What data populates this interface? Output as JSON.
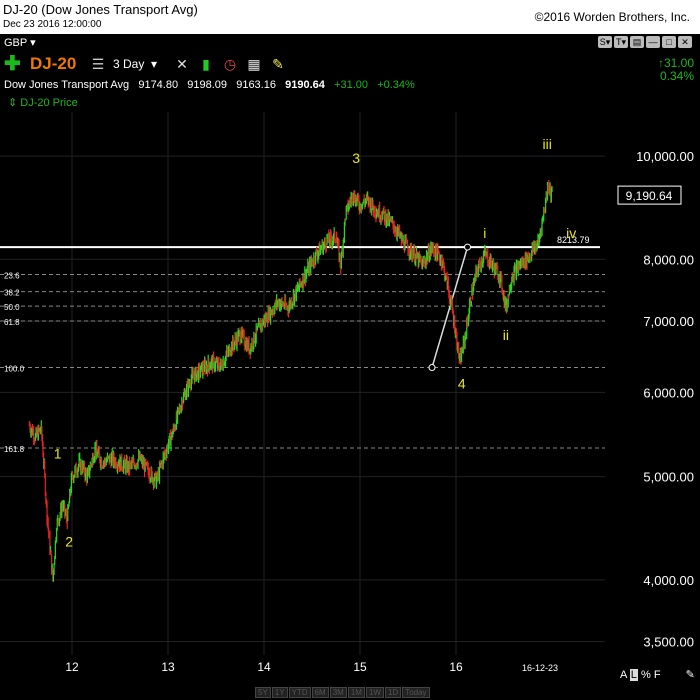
{
  "window": {
    "title": "DJ-20 (Dow Jones Transport Avg)",
    "date": "Dec 23 2016 12:00:00",
    "copyright": "©2016 Worden Brothers, Inc."
  },
  "toolbar": {
    "currency": "GBP",
    "symbol": "DJ-20",
    "period": "3 Day",
    "change_value": "31.00",
    "change_pct": "0.34%",
    "window_buttons": [
      "S",
      "T",
      "min",
      "max",
      "close"
    ]
  },
  "quote": {
    "name": "Dow Jones Transport Avg",
    "open": "9174.80",
    "high": "9198.09",
    "low": "9163.16",
    "last": "9190.64",
    "change": "+31.00",
    "change_pct": "+0.34%"
  },
  "legend": {
    "label": "DJ-20 Price"
  },
  "ranges": [
    "5Y",
    "1Y",
    "YTD",
    "6M",
    "3M",
    "1M",
    "1W",
    "1D",
    "Today"
  ],
  "scale_modes": [
    "A",
    "L",
    "%",
    "F"
  ],
  "colors": {
    "up": "#22dd22",
    "down": "#ee2222",
    "wave_label": "#e8e820",
    "hline": "#ffffff"
  },
  "chart_data": {
    "type": "ohlc",
    "y_scale": "log",
    "ylim": [
      3400,
      11000
    ],
    "y_ticks": [
      3500,
      4000,
      5000,
      6000,
      7000,
      8000,
      10000
    ],
    "y_tick_labels": [
      "3,500.00",
      "4,000.00",
      "5,000.00",
      "6,000.00",
      "7,000.00",
      "8,000.00",
      "10,000.00"
    ],
    "x_ticks": [
      12,
      13,
      14,
      15,
      16
    ],
    "x_tick_labels": [
      "12",
      "13",
      "14",
      "15",
      "16"
    ],
    "x_end_label": "16-12-23",
    "last_price_label": "9,190.64",
    "hline": {
      "value": 8213.79,
      "label": "8213.79"
    },
    "fib_levels": [
      {
        "label": "23.6",
        "value": 7740
      },
      {
        "label": "38.2",
        "value": 7460
      },
      {
        "label": "50.0",
        "value": 7230
      },
      {
        "label": "61.8",
        "value": 7000
      },
      {
        "label": "100.0",
        "value": 6330
      },
      {
        "label": "161.8",
        "value": 5320
      }
    ],
    "waves": [
      {
        "label": "1",
        "x": 11.85,
        "y": 5200
      },
      {
        "label": "2",
        "x": 11.97,
        "y": 4300
      },
      {
        "label": "3",
        "x": 14.96,
        "y": 9850
      },
      {
        "label": "4",
        "x": 16.06,
        "y": 6050
      },
      {
        "label": "i",
        "x": 16.3,
        "y": 8380
      },
      {
        "label": "ii",
        "x": 16.52,
        "y": 6720
      },
      {
        "label": "iii",
        "x": 16.95,
        "y": 10150
      },
      {
        "label": "iv",
        "x": 17.2,
        "y": 8380
      }
    ],
    "series": [
      {
        "name": "DJ-20 Price",
        "points": [
          [
            11.55,
            5600
          ],
          [
            11.62,
            5450
          ],
          [
            11.68,
            5550
          ],
          [
            11.74,
            4600
          ],
          [
            11.8,
            4000
          ],
          [
            11.84,
            4500
          ],
          [
            11.9,
            4700
          ],
          [
            11.95,
            4550
          ],
          [
            12.0,
            5000
          ],
          [
            12.08,
            5150
          ],
          [
            12.16,
            5000
          ],
          [
            12.24,
            5300
          ],
          [
            12.32,
            5150
          ],
          [
            12.4,
            5200
          ],
          [
            12.5,
            5150
          ],
          [
            12.6,
            5100
          ],
          [
            12.7,
            5200
          ],
          [
            12.8,
            5050
          ],
          [
            12.88,
            4950
          ],
          [
            12.95,
            5200
          ],
          [
            13.05,
            5500
          ],
          [
            13.15,
            5900
          ],
          [
            13.25,
            6200
          ],
          [
            13.35,
            6300
          ],
          [
            13.45,
            6400
          ],
          [
            13.55,
            6350
          ],
          [
            13.65,
            6600
          ],
          [
            13.75,
            6800
          ],
          [
            13.85,
            6600
          ],
          [
            13.95,
            6900
          ],
          [
            14.05,
            7100
          ],
          [
            14.15,
            7300
          ],
          [
            14.25,
            7200
          ],
          [
            14.35,
            7500
          ],
          [
            14.45,
            7800
          ],
          [
            14.55,
            8100
          ],
          [
            14.65,
            8300
          ],
          [
            14.75,
            8400
          ],
          [
            14.8,
            7900
          ],
          [
            14.85,
            8800
          ],
          [
            14.92,
            9200
          ],
          [
            15.0,
            9000
          ],
          [
            15.08,
            9100
          ],
          [
            15.16,
            8900
          ],
          [
            15.25,
            8800
          ],
          [
            15.35,
            8600
          ],
          [
            15.45,
            8300
          ],
          [
            15.55,
            8100
          ],
          [
            15.65,
            7900
          ],
          [
            15.75,
            8200
          ],
          [
            15.85,
            8000
          ],
          [
            15.92,
            7500
          ],
          [
            15.98,
            7000
          ],
          [
            16.04,
            6400
          ],
          [
            16.1,
            6800
          ],
          [
            16.16,
            7400
          ],
          [
            16.22,
            7800
          ],
          [
            16.3,
            8100
          ],
          [
            16.38,
            7900
          ],
          [
            16.46,
            7700
          ],
          [
            16.52,
            7200
          ],
          [
            16.58,
            7700
          ],
          [
            16.66,
            7900
          ],
          [
            16.74,
            8000
          ],
          [
            16.8,
            8150
          ],
          [
            16.86,
            8300
          ],
          [
            16.92,
            8900
          ],
          [
            16.96,
            9400
          ],
          [
            16.98,
            9300
          ],
          [
            17.0,
            9190.64
          ]
        ]
      }
    ]
  }
}
